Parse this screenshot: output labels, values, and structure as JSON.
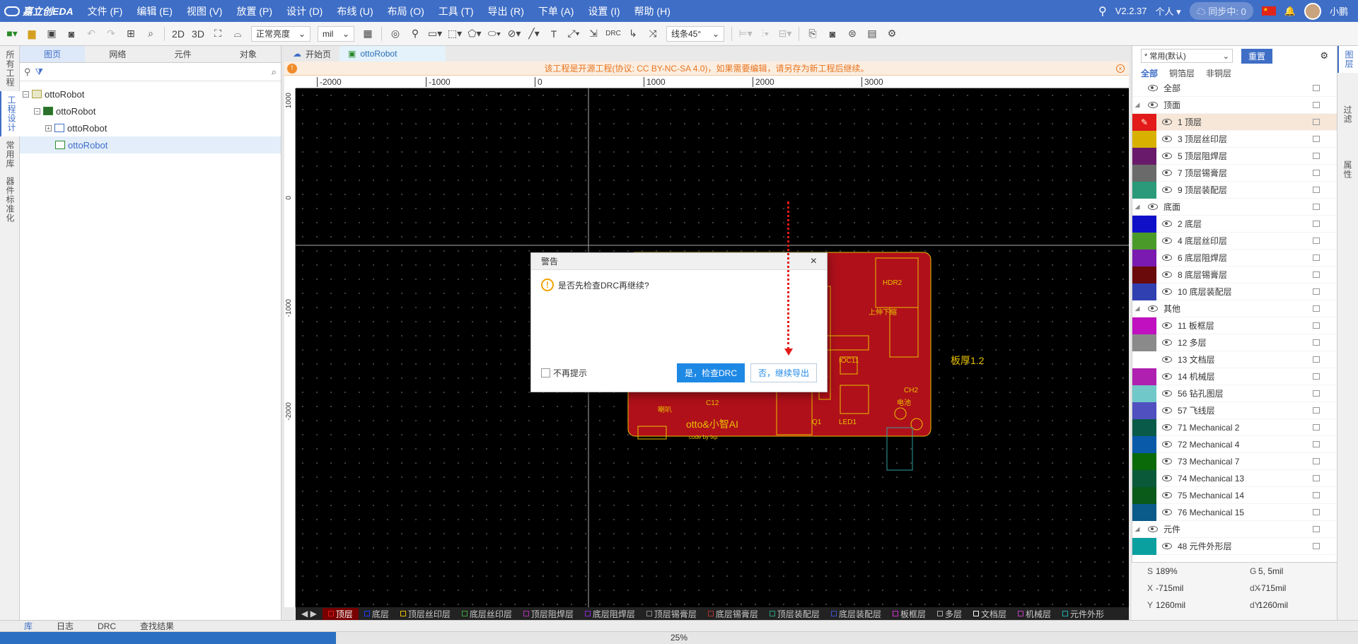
{
  "app": {
    "logo_text": "嘉立创EDA",
    "version": "V2.2.37",
    "user_mode": "个人",
    "sync_status": "同步中: 0",
    "username": "小鹏"
  },
  "menu": [
    "文件 (F)",
    "编辑 (E)",
    "视图 (V)",
    "放置 (P)",
    "设计 (D)",
    "布线 (U)",
    "布局 (O)",
    "工具 (T)",
    "导出 (R)",
    "下单 (A)",
    "设置 (I)",
    "帮助 (H)"
  ],
  "toolbar": {
    "view_2d": "2D",
    "view_3d": "3D",
    "brightness": "正常亮度",
    "unit": "mil",
    "route_mode": "线条45°",
    "drc_label": "DRC"
  },
  "left_vtabs": [
    "所有工程",
    "工程设计",
    "常用库",
    "器件标准化"
  ],
  "left_tabs": [
    "图页",
    "网络",
    "元件",
    "对象"
  ],
  "tree": [
    {
      "label": "ottoRobot",
      "level": 0
    },
    {
      "label": "ottoRobot",
      "level": 1
    },
    {
      "label": "ottoRobot",
      "level": 2
    },
    {
      "label": "ottoRobot",
      "level": 2
    }
  ],
  "doc_tabs": [
    "开始页",
    "ottoRobot"
  ],
  "banner": "该工程是开源工程(协议: CC BY-NC-SA 4.0)，如果需要编辑，请另存为新工程后继续。",
  "ruler_x": [
    "-2000",
    "-1000",
    "0",
    "1000",
    "2000",
    "3000"
  ],
  "ruler_y": [
    "1000",
    "0",
    "-1000",
    "-2000"
  ],
  "pcb": {
    "board_thickness": "板厚1.2",
    "silk_text": "otto&小智AI",
    "silk_sub": "code by lxp"
  },
  "layer_bar": [
    {
      "name": "顶层",
      "color": "#e21a1a"
    },
    {
      "name": "底层",
      "color": "#1a3cff"
    },
    {
      "name": "顶层丝印层",
      "color": "#e8c000"
    },
    {
      "name": "底层丝印层",
      "color": "#3ba53b"
    },
    {
      "name": "顶层阻焊层",
      "color": "#b030b0"
    },
    {
      "name": "底层阻焊层",
      "color": "#8a2ad8"
    },
    {
      "name": "顶层锡膏层",
      "color": "#888888"
    },
    {
      "name": "底层锡膏层",
      "color": "#b03030"
    },
    {
      "name": "顶层装配层",
      "color": "#2aa080"
    },
    {
      "name": "底层装配层",
      "color": "#4050d0"
    },
    {
      "name": "板框层",
      "color": "#d030d0"
    },
    {
      "name": "多层",
      "color": "#aaaaaa"
    },
    {
      "name": "文档层",
      "color": "#ffffff"
    },
    {
      "name": "机械层",
      "color": "#c040c0"
    },
    {
      "name": "元件外形",
      "color": "#20b0b0"
    }
  ],
  "right_panel": {
    "preset": "* 常用(默认)",
    "reset": "重置",
    "sub_tabs": [
      "全部",
      "铜箔层",
      "非铜层"
    ],
    "layers": [
      {
        "name": "全部",
        "group": true,
        "color": ""
      },
      {
        "name": "顶面",
        "group": true,
        "color": ""
      },
      {
        "name": "1 顶层",
        "color": "#e21a1a",
        "active": true
      },
      {
        "name": "3 顶层丝印层",
        "color": "#d8b000"
      },
      {
        "name": "5 顶层阻焊层",
        "color": "#6a1a6a"
      },
      {
        "name": "7 顶层锡膏层",
        "color": "#6a6a6a"
      },
      {
        "name": "9 顶层装配层",
        "color": "#2a9a7a"
      },
      {
        "name": "底面",
        "group": true,
        "color": ""
      },
      {
        "name": "2 底层",
        "color": "#1010c8"
      },
      {
        "name": "4 底层丝印层",
        "color": "#4a9a2a"
      },
      {
        "name": "6 底层阻焊层",
        "color": "#7a1ab0"
      },
      {
        "name": "8 底层锡膏层",
        "color": "#6a0a0a"
      },
      {
        "name": "10 底层装配层",
        "color": "#3040b0"
      },
      {
        "name": "其他",
        "group": true,
        "color": ""
      },
      {
        "name": "11 板框层",
        "color": "#c010c0"
      },
      {
        "name": "12 多层",
        "color": "#8a8a8a"
      },
      {
        "name": "13 文档层",
        "color": "#ffffff"
      },
      {
        "name": "14 机械层",
        "color": "#b020b0"
      },
      {
        "name": "56 钻孔图层",
        "color": "#70c8c8"
      },
      {
        "name": "57 飞线层",
        "color": "#5050c0"
      },
      {
        "name": "71 Mechanical 2",
        "color": "#0a5a4a"
      },
      {
        "name": "72 Mechanical 4",
        "color": "#0a5aaa"
      },
      {
        "name": "73 Mechanical 7",
        "color": "#0a6a0a"
      },
      {
        "name": "74 Mechanical 13",
        "color": "#0a5a3a"
      },
      {
        "name": "75 Mechanical 14",
        "color": "#0a5a1a"
      },
      {
        "name": "76 Mechanical 15",
        "color": "#0a5a8a"
      },
      {
        "name": "元件",
        "group": true,
        "color": ""
      },
      {
        "name": "48 元件外形层",
        "color": "#0aa0a0"
      }
    ]
  },
  "right_vtabs": [
    "图层",
    "过滤",
    "属性"
  ],
  "status": {
    "S": "189%",
    "G": "5, 5mil",
    "X": "-715mil",
    "dX": "-715mil",
    "Y": "1260mil",
    "dY": "1260mil"
  },
  "bottom_tabs": [
    "库",
    "日志",
    "DRC",
    "查找结果"
  ],
  "progress": {
    "value": 0.25,
    "text": "25%"
  },
  "dialog": {
    "title": "警告",
    "message": "是否先检查DRC再继续?",
    "dont_show": "不再提示",
    "yes": "是，检查DRC",
    "no": "否，继续导出"
  }
}
